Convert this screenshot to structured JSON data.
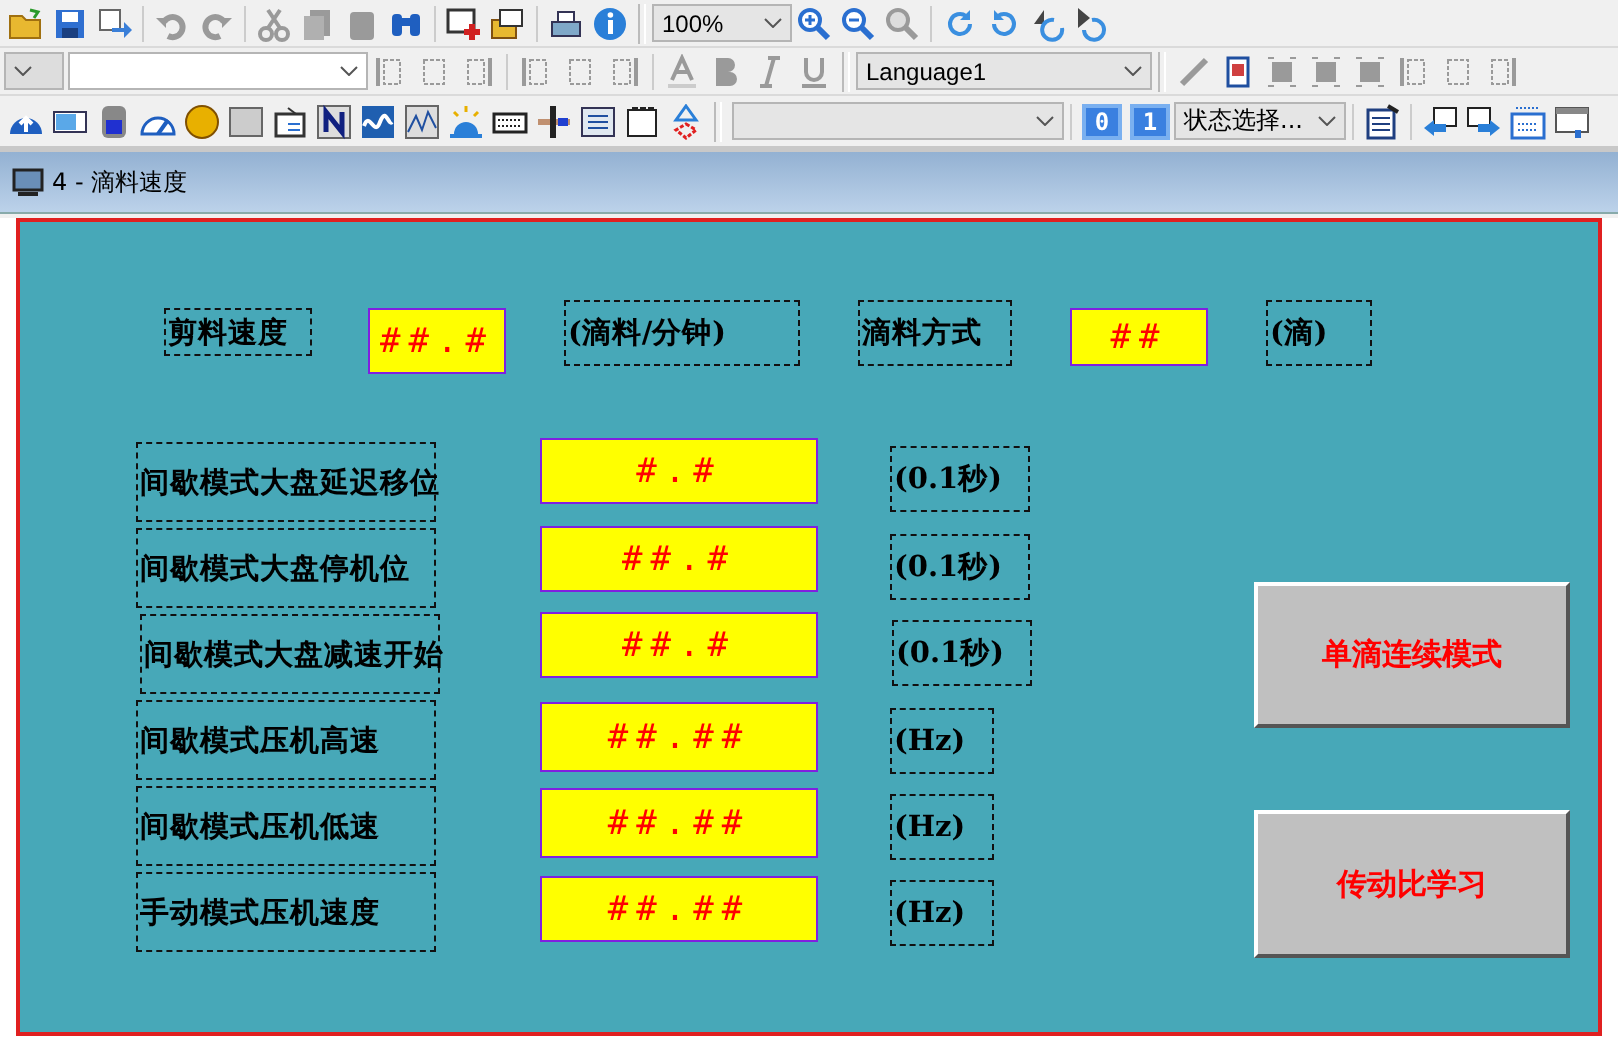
{
  "toolbar": {
    "zoom": "100%",
    "language": "Language1",
    "state_select": "状态选择...",
    "state_buttons": [
      "0",
      "1"
    ]
  },
  "screen_tab": {
    "title": "4 - 滴料速度"
  },
  "canvas": {
    "objects": [
      {
        "kind": "label",
        "text": "剪料速度"
      },
      {
        "kind": "field",
        "text": "##.#"
      },
      {
        "kind": "label",
        "text": "(滴料/分钟)"
      },
      {
        "kind": "label",
        "text": "滴料方式"
      },
      {
        "kind": "field",
        "text": "##"
      },
      {
        "kind": "label",
        "text": "(滴)"
      },
      {
        "kind": "label",
        "text": "间歇模式大盘延迟移位"
      },
      {
        "kind": "field",
        "text": "#.#"
      },
      {
        "kind": "label",
        "text": "(0.1秒)"
      },
      {
        "kind": "label",
        "text": "间歇模式大盘停机位"
      },
      {
        "kind": "field",
        "text": "##.#"
      },
      {
        "kind": "label",
        "text": "(0.1秒)"
      },
      {
        "kind": "label",
        "text": "间歇模式大盘减速开始"
      },
      {
        "kind": "field",
        "text": "##.#"
      },
      {
        "kind": "label",
        "text": "(0.1秒)"
      },
      {
        "kind": "label",
        "text": "间歇模式压机高速"
      },
      {
        "kind": "field",
        "text": "##.##"
      },
      {
        "kind": "label",
        "text": "(Hz)"
      },
      {
        "kind": "label",
        "text": "间歇模式压机低速"
      },
      {
        "kind": "field",
        "text": "##.##"
      },
      {
        "kind": "label",
        "text": "(Hz)"
      },
      {
        "kind": "label",
        "text": "手动模式压机速度"
      },
      {
        "kind": "field",
        "text": "##.##"
      },
      {
        "kind": "label",
        "text": "(Hz)"
      },
      {
        "kind": "button",
        "text": "单滴连续模式"
      },
      {
        "kind": "button",
        "text": "传动比学习"
      }
    ]
  }
}
